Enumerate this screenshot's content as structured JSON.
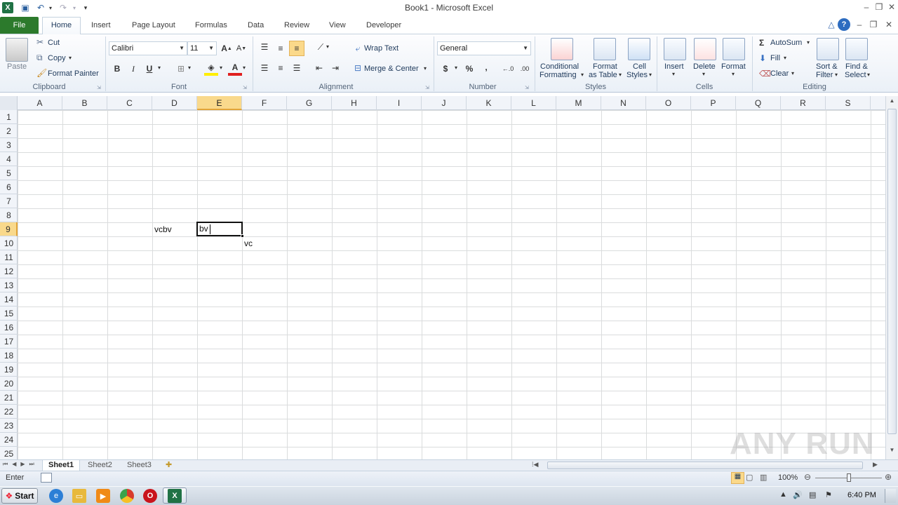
{
  "window": {
    "title": "Book1 - Microsoft Excel",
    "app_icon": "excel-icon"
  },
  "quick_access": {
    "save": "save-icon",
    "undo": "undo-icon",
    "redo": "redo-icon",
    "customize": "▾"
  },
  "tabs": [
    "Insert",
    "Page Layout",
    "Formulas",
    "Data",
    "Review",
    "View",
    "Developer"
  ],
  "file_tab": "File",
  "home_tab": "Home",
  "clipboard": {
    "paste": "Paste",
    "cut": "Cut",
    "copy": "Copy",
    "format_painter": "Format Painter",
    "label": "Clipboard"
  },
  "font": {
    "name": "Calibri",
    "size": "11",
    "bold": "B",
    "italic": "I",
    "underline": "U",
    "label": "Font"
  },
  "alignment": {
    "wrap_text": "Wrap Text",
    "merge_center": "Merge & Center",
    "label": "Alignment"
  },
  "number": {
    "format": "General",
    "currency": "$",
    "percent": "%",
    "comma": ",",
    "label": "Number"
  },
  "styles": {
    "conditional": "Conditional",
    "formatting": "Formatting",
    "format": "Format",
    "as_table": "as Table",
    "cell": "Cell",
    "cell_styles": "Styles",
    "label": "Styles"
  },
  "cells": {
    "insert": "Insert",
    "delete": "Delete",
    "format": "Format",
    "label": "Cells"
  },
  "editing": {
    "autosum": "AutoSum",
    "fill": "Fill",
    "clear": "Clear",
    "sort": "Sort &",
    "filter": "Filter",
    "find": "Find &",
    "select": "Select",
    "label": "Editing"
  },
  "columns": [
    "A",
    "B",
    "C",
    "D",
    "E",
    "F",
    "G",
    "H",
    "I",
    "J",
    "K",
    "L",
    "M",
    "N",
    "O",
    "P",
    "Q",
    "R",
    "S"
  ],
  "selected_column": "E",
  "rows": [
    "1",
    "2",
    "3",
    "4",
    "5",
    "6",
    "7",
    "8",
    "9",
    "10",
    "11",
    "12",
    "13",
    "14",
    "15",
    "16",
    "17",
    "18",
    "19",
    "20",
    "21",
    "22",
    "23",
    "24",
    "25"
  ],
  "selected_row": "9",
  "cell_values": {
    "D9": "vcbv",
    "E9": "bv",
    "F10": "vc"
  },
  "sheets": [
    "Sheet1",
    "Sheet2",
    "Sheet3"
  ],
  "active_sheet": "Sheet1",
  "status": {
    "mode": "Enter",
    "zoom": "100%"
  },
  "taskbar": {
    "start": "Start",
    "time": "6:40 PM"
  },
  "watermark": "ANY RUN",
  "colors": {
    "file_tab": "#2c7a2c",
    "selection_header": "#f9d98c"
  }
}
